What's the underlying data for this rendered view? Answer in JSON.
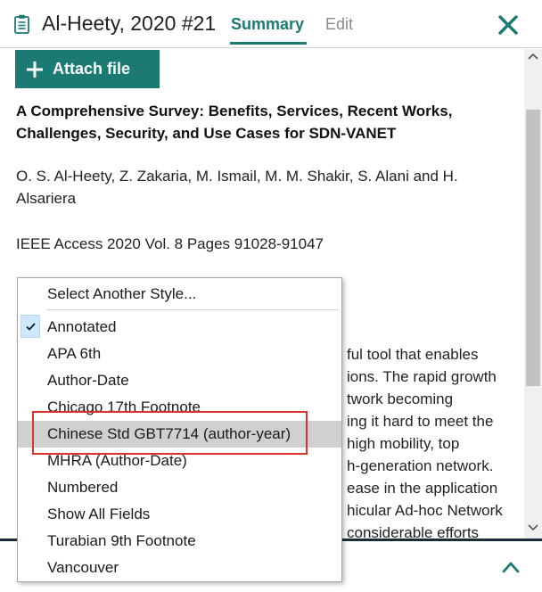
{
  "header": {
    "reference_title": "Al-Heety, 2020 #21",
    "tabs": [
      {
        "label": "Summary",
        "active": true
      },
      {
        "label": "Edit",
        "active": false
      }
    ],
    "close_icon": "close-x-icon",
    "reference_icon": "clipboard-icon"
  },
  "toolbar": {
    "attach_label": "Attach file",
    "attach_icon": "plus-icon"
  },
  "reference": {
    "title_line1": "A Comprehensive Survey: Benefits, Services, Recent Works,",
    "title_line2": "Challenges, Security, and Use Cases for SDN-VANET",
    "authors_line1": "O. S. Al-Heety, Z. Zakaria, M. Ismail, M. M. Shakir, S. Alani and H.",
    "authors_line2": "Alsariera",
    "journal": "IEEE Access 2020 Vol. 8 Pages 91028-91047"
  },
  "abstract_visible_fragments": [
    "ful tool that enables",
    "ions. The rapid growth",
    "twork becoming",
    "ing it hard to meet the",
    "high mobility, top",
    "h-generation network.",
    "ease in the application",
    "hicular Ad-hoc Network",
    "considerable efforts"
  ],
  "style_menu": {
    "header_item": "Select Another Style...",
    "items": [
      {
        "label": "Annotated",
        "checked": true
      },
      {
        "label": "APA 6th",
        "checked": false
      },
      {
        "label": "Author-Date",
        "checked": false
      },
      {
        "label": "Chicago 17th Footnote",
        "checked": false
      },
      {
        "label": "Chinese Std GBT7714 (author-year)",
        "checked": false,
        "hovered": true
      },
      {
        "label": "MHRA (Author-Date)",
        "checked": false
      },
      {
        "label": "Numbered",
        "checked": false
      },
      {
        "label": "Show All Fields",
        "checked": false
      },
      {
        "label": "Turabian 9th Footnote",
        "checked": false
      },
      {
        "label": "Vancouver",
        "checked": false
      }
    ]
  },
  "colors": {
    "accent": "#1b7a72",
    "annotation_box": "#d9342b",
    "menu_hover": "#d0d0d0",
    "check_bg": "#cde8ff"
  }
}
